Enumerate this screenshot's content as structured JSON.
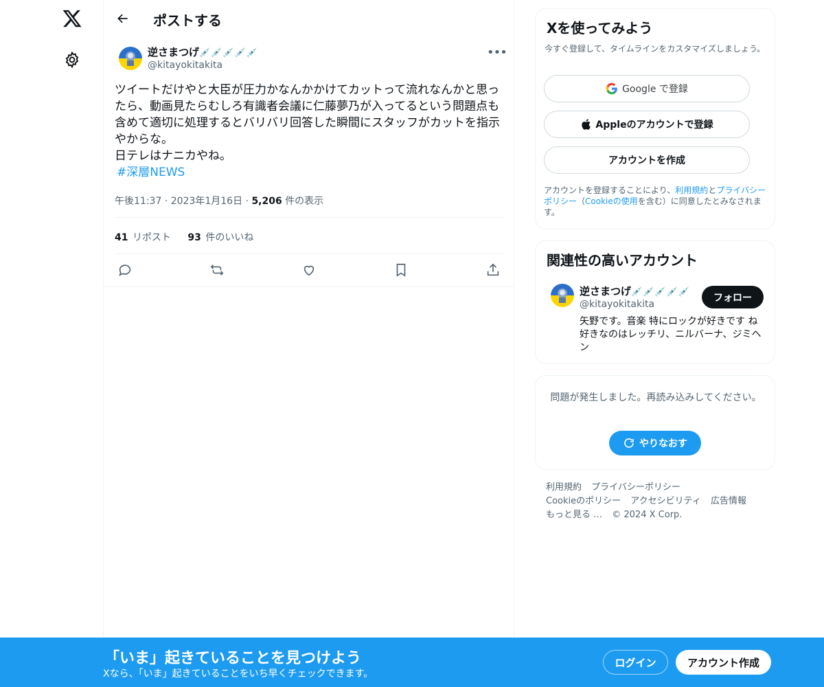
{
  "header": {
    "title": "ポストする"
  },
  "post": {
    "author_name": "逆さまつげ",
    "author_emoji": "💉💉💉💉💉",
    "author_handle": "@kitayokitakita",
    "text_lines": [
      "ツイートだけやと大臣が圧力かなんかかけてカットって流れなんかと思ったら、動画見たらむしろ有識者会議に仁藤夢乃が入ってるという問題点も含めて適切に処理するとバリバリ回答した瞬間にスタッフがカットを指示やからな。",
      "日テレはナニカやね。"
    ],
    "hashtag": "#深層NEWS",
    "time": "午後11:37",
    "date": "2023年1月16日",
    "separator": "·",
    "views_count": "5,206",
    "views_label": "件の表示",
    "reposts_count": "41",
    "reposts_label": "リポスト",
    "likes_count": "93",
    "likes_label": "件のいいね"
  },
  "signup": {
    "title": "Xを使ってみよう",
    "subtitle": "今すぐ登録して、タイムラインをカスタマイズしましょう。",
    "google_label": "Google で登録",
    "apple_label": "Appleのアカウントで登録",
    "create_label": "アカウントを作成",
    "legal_prefix": "アカウントを登録することにより、",
    "legal_terms": "利用規約",
    "legal_and": "と",
    "legal_privacy": "プライバシーポリシー",
    "legal_paren_open": "（",
    "legal_cookie": "Cookieの使用",
    "legal_suffix": "を含む）に同意したとみなされます。"
  },
  "related": {
    "title": "関連性の高いアカウント",
    "name": "逆さまつげ",
    "emoji": "💉💉💉💉💉",
    "handle": "@kitayokitakita",
    "follow_label": "フォロー",
    "bio": "矢野です。音楽 特にロックが好きです ね 好きなのはレッチリ、ニルバーナ、ジミヘン"
  },
  "error": {
    "message": "問題が発生しました。再読み込みしてください。",
    "retry_label": "やりなおす"
  },
  "footer": {
    "terms": "利用規約",
    "privacy": "プライバシーポリシー",
    "cookie": "Cookieのポリシー",
    "accessibility": "アクセシビリティ",
    "ads": "広告情報",
    "more": "もっと見る …",
    "copyright": "© 2024 X Corp."
  },
  "banner": {
    "title": "「いま」起きていることを見つけよう",
    "subtitle": "Xなら、「いま」起きていることをいち早くチェックできます。",
    "login_label": "ログイン",
    "create_label": "アカウント作成"
  },
  "colors": {
    "accent": "#1d9bf0",
    "text": "#0f1419",
    "muted": "#536471"
  }
}
